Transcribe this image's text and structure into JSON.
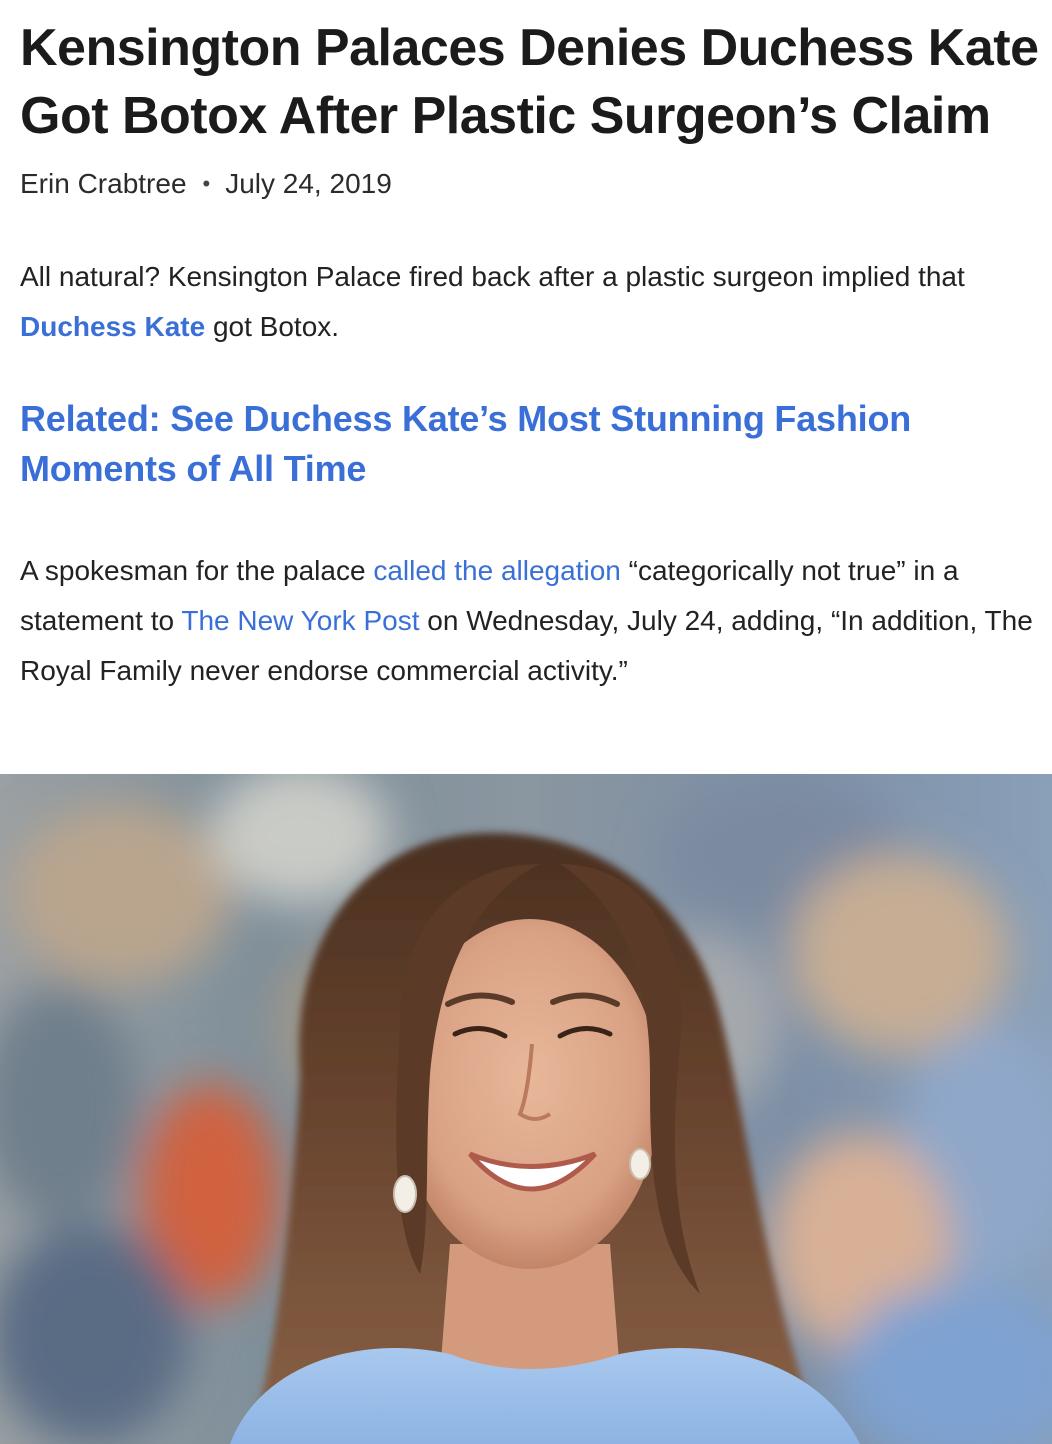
{
  "article": {
    "headline": "Kensington Palaces Denies Duchess Kate Got Botox After Plastic Surgeon’s Claim",
    "author": "Erin Crabtree",
    "separator": "•",
    "date": "July 24, 2019",
    "intro": {
      "before": "All natural? Kensington Palace fired back after a plastic surgeon implied that ",
      "link": "Duchess Kate",
      "after": " got Botox."
    },
    "related": "Related: See Duchess Kate’s Most Stunning Fashion Moments of All Time",
    "body": {
      "t1": "A spokesman for the palace ",
      "link1": "called the allegation",
      "t2": " “categorically not true” in a statement to ",
      "link2": "The New York Post",
      "t3": " on Wednesday, July 24, adding, “In addition, The Royal Family never endorse commercial activity.”"
    }
  },
  "colors": {
    "link": "#3a6fd8",
    "text": "#1a1a1a"
  }
}
